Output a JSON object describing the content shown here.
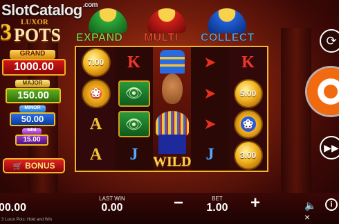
{
  "watermark": {
    "text": "SlotCatalog",
    "suffix": ".com"
  },
  "logo": {
    "number": "3",
    "top": "LUXOR",
    "bottom": "POTS"
  },
  "jackpots": {
    "grand": {
      "label": "GRAND",
      "value": "1000.00"
    },
    "major": {
      "label": "MAJOR",
      "value": "150.00"
    },
    "minor": {
      "label": "MINOR",
      "value": "50.00"
    },
    "mini": {
      "label": "MINI",
      "value": "15.00"
    }
  },
  "bonus_button": {
    "label": "BONUS",
    "icon": "cart-icon"
  },
  "pots": {
    "expand": {
      "label": "EXPAND",
      "color": "#7de056"
    },
    "multi": {
      "label": "MULTI",
      "color": "#ff4a3a"
    },
    "collect": {
      "label": "COLLECT",
      "color": "#58a8ff"
    }
  },
  "reels": [
    [
      {
        "type": "coin",
        "value": "7.00"
      },
      {
        "type": "coin-scarab-red",
        "value": ""
      },
      {
        "type": "letter",
        "value": "A"
      },
      {
        "type": "letter",
        "value": "A"
      }
    ],
    [
      {
        "type": "letter",
        "value": "K"
      },
      {
        "type": "eye",
        "value": ""
      },
      {
        "type": "eye",
        "value": ""
      },
      {
        "type": "letter",
        "value": "J"
      }
    ],
    [
      {
        "type": "wild",
        "value": "WILD"
      }
    ],
    [
      {
        "type": "feather",
        "value": ""
      },
      {
        "type": "feather",
        "value": ""
      },
      {
        "type": "feather",
        "value": ""
      },
      {
        "type": "letter",
        "value": "J"
      }
    ],
    [
      {
        "type": "letter",
        "value": "K"
      },
      {
        "type": "coin",
        "value": "5.00"
      },
      {
        "type": "coin-scarab-blue",
        "value": ""
      },
      {
        "type": "coin",
        "value": "3.00"
      }
    ]
  ],
  "bottom": {
    "balance": "00.00",
    "last_win_label": "LAST WIN",
    "last_win": "0.00",
    "bet_label": "BET",
    "bet": "1.00",
    "minus": "−",
    "plus": "+",
    "footer": "3 Luxor Pots: Hold and Win"
  },
  "controls": {
    "autoplay_icon": "autoplay-icon",
    "spin_icon": "spin-icon",
    "turbo_icon": "turbo-icon",
    "sound_icon": "sound-off-icon",
    "info_icon": "info-icon",
    "info_text": "i"
  }
}
